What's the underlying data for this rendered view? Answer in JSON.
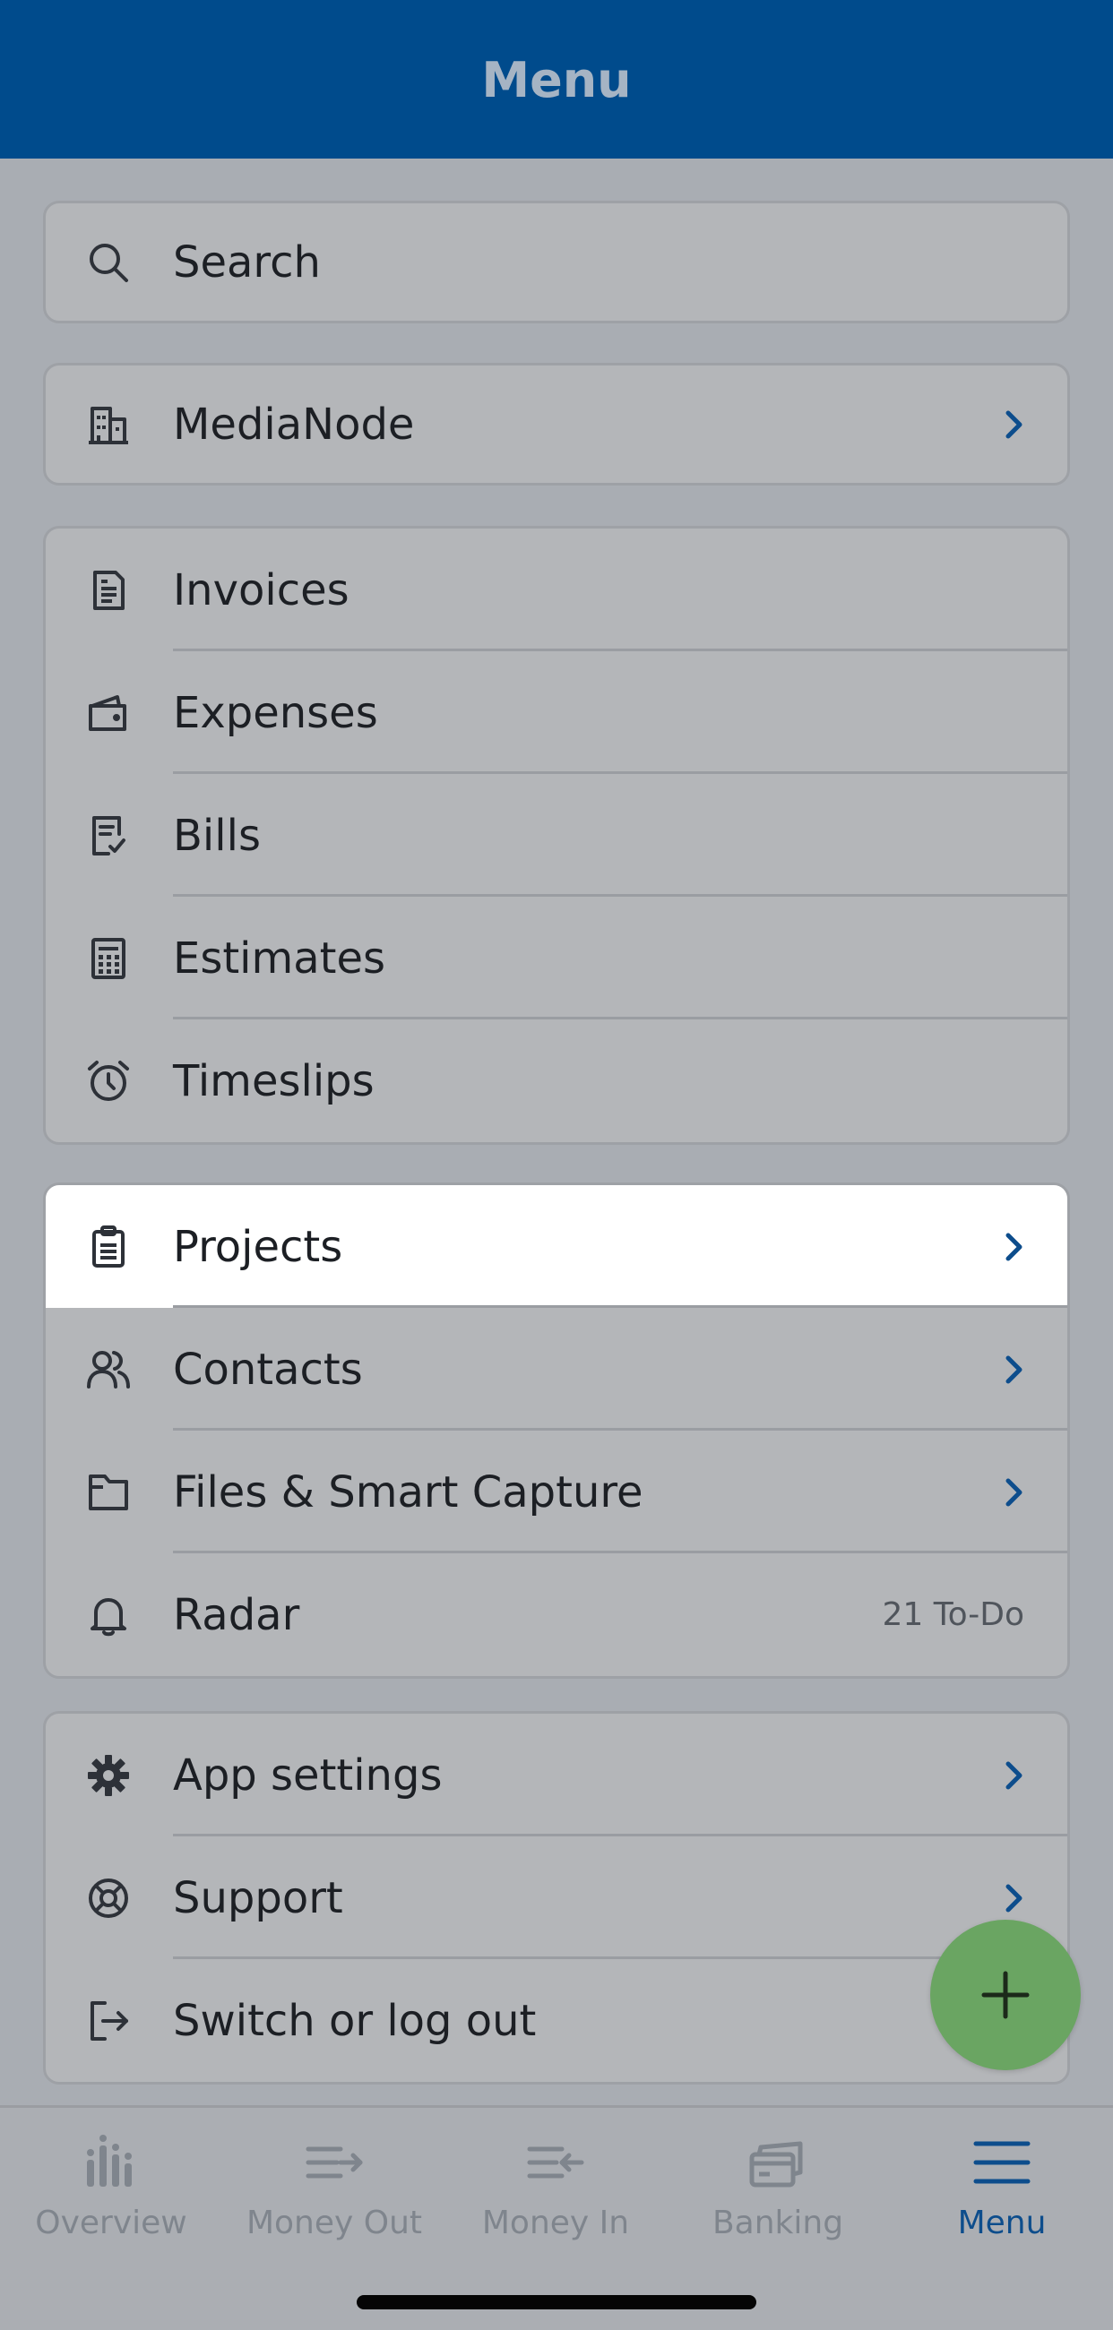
{
  "header": {
    "title": "Menu"
  },
  "search": {
    "label": "Search"
  },
  "organization": {
    "label": "MediaNode"
  },
  "group1": [
    {
      "label": "Invoices",
      "icon": "invoice-icon"
    },
    {
      "label": "Expenses",
      "icon": "wallet-icon"
    },
    {
      "label": "Bills",
      "icon": "bill-icon"
    },
    {
      "label": "Estimates",
      "icon": "calculator-icon"
    },
    {
      "label": "Timeslips",
      "icon": "alarm-clock-icon"
    }
  ],
  "group2": [
    {
      "label": "Projects",
      "icon": "clipboard-icon"
    },
    {
      "label": "Contacts",
      "icon": "contacts-icon"
    },
    {
      "label": "Files & Smart Capture",
      "icon": "folder-icon"
    },
    {
      "label": "Radar",
      "icon": "bell-icon",
      "badge": "21 To-Do"
    }
  ],
  "group3": [
    {
      "label": "App settings",
      "icon": "gear-icon"
    },
    {
      "label": "Support",
      "icon": "lifebuoy-icon"
    },
    {
      "label": "Switch or log out",
      "icon": "logout-icon"
    }
  ],
  "tabs": [
    {
      "label": "Overview",
      "icon": "overview-icon"
    },
    {
      "label": "Money Out",
      "icon": "money-out-icon"
    },
    {
      "label": "Money In",
      "icon": "money-in-icon"
    },
    {
      "label": "Banking",
      "icon": "banking-icon"
    },
    {
      "label": "Menu",
      "icon": "hamburger-icon"
    }
  ],
  "colors": {
    "header_bg": "#004b8c",
    "accent": "#0d4d8c",
    "fab": "#6aa562",
    "highlight_row": "#ffffff"
  }
}
